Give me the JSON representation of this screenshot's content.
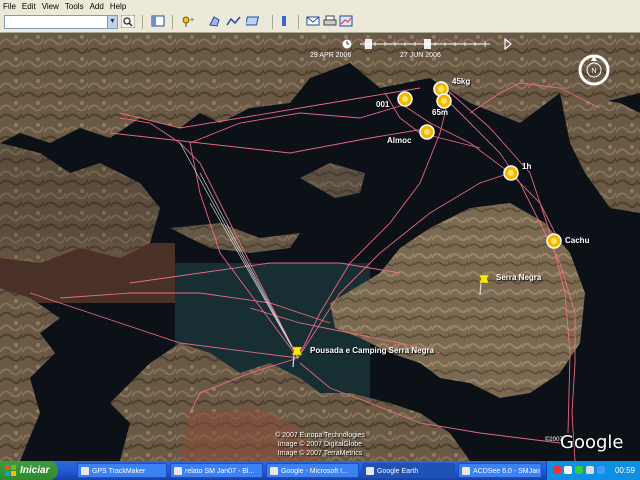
{
  "menu": [
    "File",
    "Edit",
    "View",
    "Tools",
    "Add",
    "Help"
  ],
  "search": {
    "value": "",
    "dropdown_icon": "chevron-down-icon",
    "button_icon": "search-icon"
  },
  "timeline": {
    "start": "29 APR 2006",
    "end": "27 JUN 2006"
  },
  "places": [
    {
      "label": "001",
      "type": "waypoint"
    },
    {
      "label": "45kg",
      "type": "waypoint"
    },
    {
      "label": "65m",
      "type": "waypoint"
    },
    {
      "label": "Almoc",
      "type": "waypoint"
    },
    {
      "label": "1h",
      "type": "waypoint"
    },
    {
      "label": "Cachu",
      "type": "waypoint"
    },
    {
      "label": "Serra Negra",
      "type": "placemark"
    },
    {
      "label": "Pousada e Camping Serra Negra",
      "type": "placemark"
    }
  ],
  "copyright": [
    "© 2007 Europa Technologies",
    "Image © 2007 DigitalGlobe",
    "Image © 2007 TerraMetrics"
  ],
  "logo": "Google",
  "logo_year": "©2007",
  "taskbar": {
    "start_label": "Iniciar",
    "tasks": [
      "GPS TrackMaker",
      "relato SM Jan07 - Bl...",
      "Google - Microsoft I...",
      "Google Earth",
      "ACDSee 6.0 - SMJan"
    ],
    "active_task": "Google Earth",
    "clock": "00:59"
  },
  "colors": {
    "track": "#ff6f8a",
    "water": "#0c1118",
    "land": "#6b5a44",
    "taskbar": "#245edb",
    "start": "#3a963a"
  }
}
